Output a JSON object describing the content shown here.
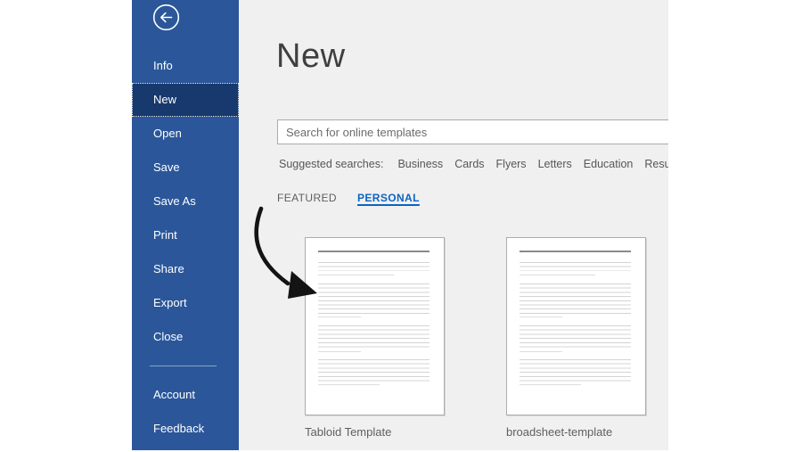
{
  "colors": {
    "sidebar_background": "#2b579a",
    "sidebar_selected_background": "#17396d",
    "main_background": "#f0f0f1",
    "accent_link_blue": "#0d64c0",
    "text_gray": "#5f5f5f",
    "annotation_arrow": "#141414"
  },
  "sidebar": {
    "back_icon": "back-arrow-icon",
    "items": [
      {
        "label": "Info",
        "selected": false
      },
      {
        "label": "New",
        "selected": true
      },
      {
        "label": "Open",
        "selected": false
      },
      {
        "label": "Save",
        "selected": false
      },
      {
        "label": "Save As",
        "selected": false
      },
      {
        "label": "Print",
        "selected": false
      },
      {
        "label": "Share",
        "selected": false
      },
      {
        "label": "Export",
        "selected": false
      },
      {
        "label": "Close",
        "selected": false
      }
    ],
    "footer_items": [
      {
        "label": "Account"
      },
      {
        "label": "Feedback"
      }
    ]
  },
  "main": {
    "title": "New",
    "search": {
      "placeholder": "Search for online templates"
    },
    "suggested": {
      "label": "Suggested searches:",
      "links": [
        "Business",
        "Cards",
        "Flyers",
        "Letters",
        "Education",
        "Resume"
      ]
    },
    "tabs": [
      {
        "label": "FEATURED",
        "selected": false
      },
      {
        "label": "PERSONAL",
        "selected": true
      }
    ],
    "templates": [
      {
        "name": "Tabloid Template"
      },
      {
        "name": "broadsheet-template"
      }
    ]
  },
  "annotation": {
    "arrow_target": "Tabloid Template"
  }
}
